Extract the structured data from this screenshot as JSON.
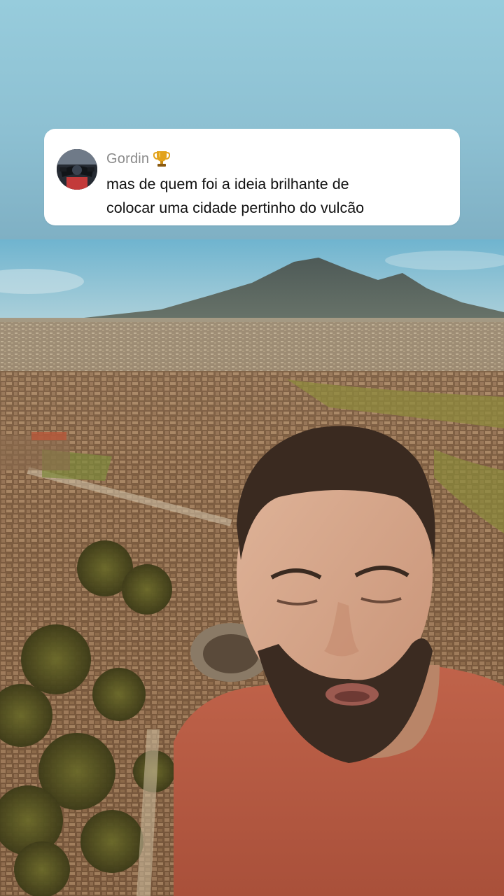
{
  "comment": {
    "username": "Gordin",
    "badge_icon": "trophy-icon",
    "text_lines": [
      "mas de quem foi a ideia brilhante de",
      "colocar uma cidade pertinho do vulcão"
    ]
  },
  "video": {
    "background_scene": "aerial-ruins-with-volcano",
    "presenter": "presenter-figure"
  },
  "colors": {
    "sky_top": "#97ccdc",
    "card_bg": "#ffffff",
    "username": "#8a8a8a",
    "comment_text": "#111111",
    "shirt": "#c0634a"
  }
}
